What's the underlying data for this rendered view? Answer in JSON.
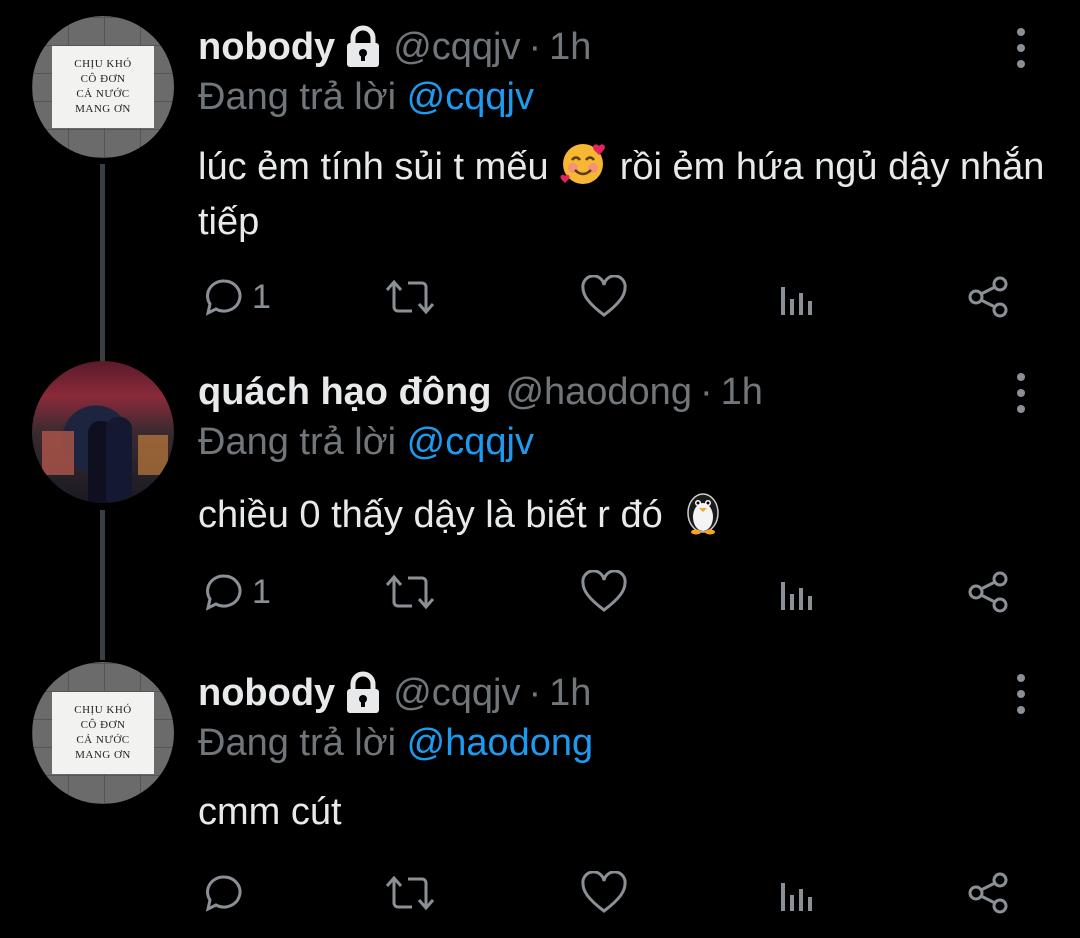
{
  "tweets": [
    {
      "name": "nobody",
      "handle": "@cqqjv",
      "separator": "·",
      "time": "1h",
      "replying_prefix": "Đang trả lời",
      "replying_to": "@cqqjv",
      "text_before_emoji": "lúc ẻm tính sủi t mếu",
      "text_after_emoji": "rồi ẻm hứa ngủ dậy nhắn tiếp",
      "emoji": "smiling-face-with-hearts",
      "reply_count": "1",
      "avatar_text": [
        "CHỊU KHÓ",
        "CÔ ĐƠN",
        "CẢ NƯỚC",
        "MANG ƠN"
      ]
    },
    {
      "name": "quách hạo đông",
      "handle": "@haodong",
      "separator": "·",
      "time": "1h",
      "replying_prefix": "Đang trả lời",
      "replying_to": "@cqqjv",
      "text_before_emoji": "chiều 0 thấy dậy là biết r đó",
      "text_after_emoji": "",
      "emoji": "penguin",
      "reply_count": "1"
    },
    {
      "name": "nobody",
      "handle": "@cqqjv",
      "separator": "·",
      "time": "1h",
      "replying_prefix": "Đang trả lời",
      "replying_to": "@haodong",
      "text_before_emoji": "cmm cút",
      "text_after_emoji": "",
      "emoji": "",
      "reply_count": "",
      "avatar_text": [
        "CHỊU KHÓ",
        "CÔ ĐƠN",
        "CẢ NƯỚC",
        "MANG ƠN"
      ]
    }
  ],
  "icons": {
    "reply": "reply-icon",
    "retweet": "retweet-icon",
    "like": "heart-icon",
    "views": "analytics-icon",
    "share": "share-icon",
    "more": "more-vertical-icon",
    "lock": "lock-icon"
  },
  "colors": {
    "background": "#000000",
    "text": "#e7e9ea",
    "muted": "#71767b",
    "mention": "#1d9bf0",
    "thread_line": "#3a3f45"
  }
}
